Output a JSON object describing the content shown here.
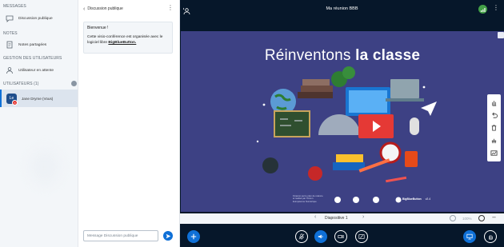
{
  "userlist": {
    "messages_title": "MESSAGES",
    "public_chat_label": "Discussion publique",
    "notes_title": "NOTES",
    "shared_notes_label": "Notes partagées",
    "management_title": "GESTION DES UTILISATEURS",
    "waiting_users_label": "Utilisateur en attente",
    "users_title": "UTILISATEURS (1)",
    "current_user": {
      "initials": "Le",
      "name": "Jane Dryme (Vous)"
    }
  },
  "chat": {
    "title": "Discussion publique",
    "welcome_title": "Bienvenue !",
    "welcome_text": "Cette visio-conférence est organisée avec le logiciel libre",
    "welcome_link": "BigBlueButton.",
    "input_placeholder": "Message Discussion publique"
  },
  "header": {
    "meeting_title": "Ma réunion BBB"
  },
  "slide": {
    "title_light": "Réinventons",
    "title_bold": "la classe",
    "credits": "Financé par le plan de relance et réalisé par l'Union Européenne Numérique",
    "logo_text": "BigBlueButton",
    "version": "v2.4"
  },
  "slide_controls": {
    "current_slide": "Diapositive 1",
    "zoom_level": "100%"
  },
  "colors": {
    "accent": "#0f70d7",
    "dark_background": "#06172a",
    "slide_background": "#3d4184",
    "connection_ok": "#43a047",
    "alert": "#e53935"
  }
}
